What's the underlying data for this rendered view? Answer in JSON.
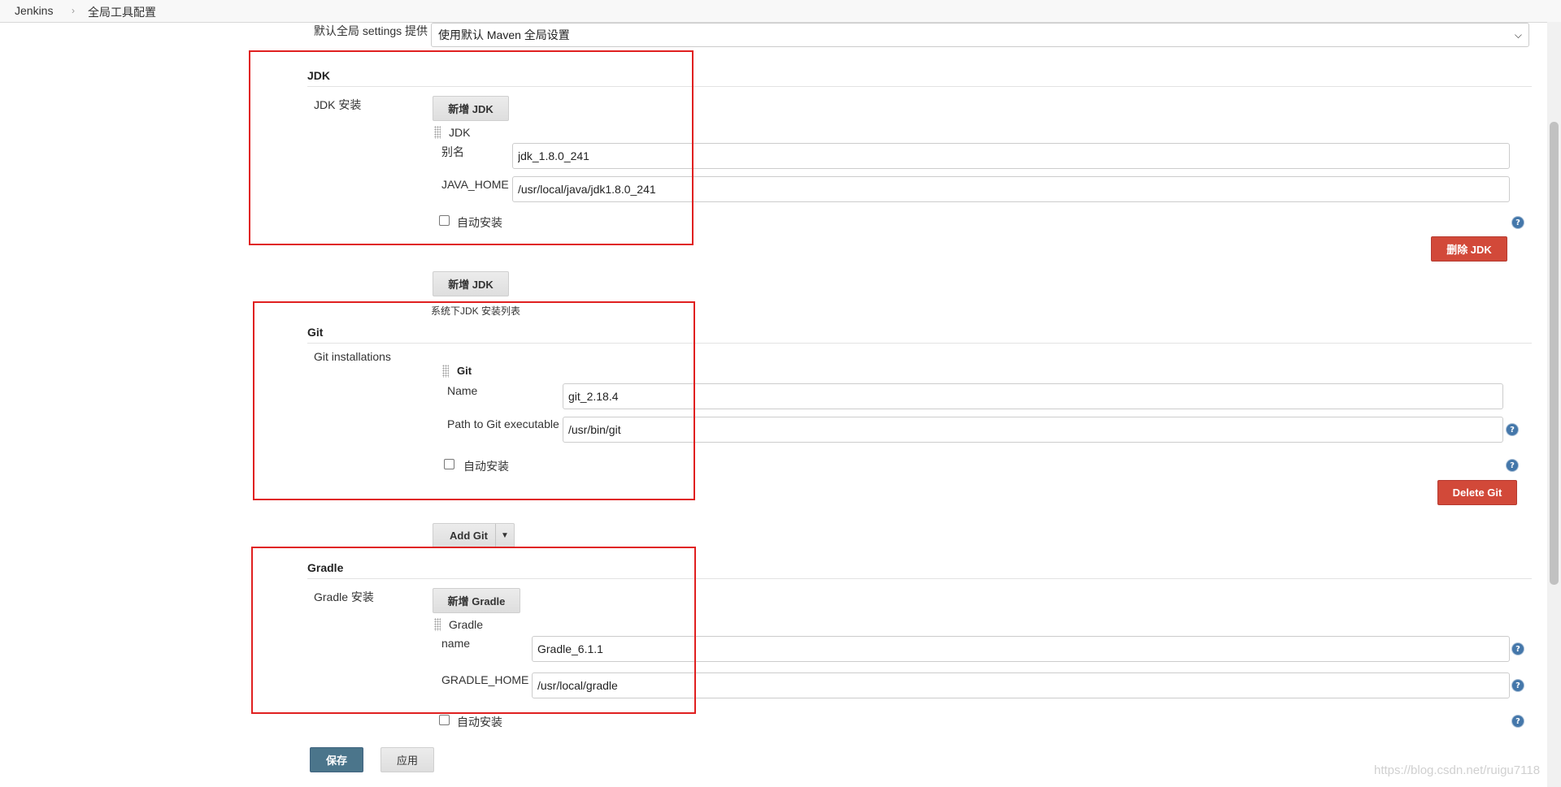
{
  "breadcrumb": {
    "items": [
      "Jenkins",
      "全局工具配置"
    ],
    "separator": "›"
  },
  "maven_settings": {
    "label": "默认全局 settings 提供",
    "selected": "使用默认 Maven 全局设置"
  },
  "jdk": {
    "section_title": "JDK",
    "install_label": "JDK 安装",
    "add_button": "新增 JDK",
    "item_title": "JDK",
    "alias_label": "别名",
    "alias_value": "jdk_1.8.0_241",
    "home_label": "JAVA_HOME",
    "home_value": "/usr/local/java/jdk1.8.0_241",
    "auto_install_label": "自动安装",
    "delete_button": "删除 JDK",
    "add_button_bottom": "新增 JDK",
    "list_hint": "系统下JDK 安装列表"
  },
  "git": {
    "section_title": "Git",
    "install_label": "Git installations",
    "item_title": "Git",
    "name_label": "Name",
    "name_value": "git_2.18.4",
    "path_label": "Path to Git executable",
    "path_value": "/usr/bin/git",
    "auto_install_label": "自动安装",
    "delete_button": "Delete Git",
    "add_button": "Add Git"
  },
  "gradle": {
    "section_title": "Gradle",
    "install_label": "Gradle 安装",
    "add_button": "新增 Gradle",
    "item_title": "Gradle",
    "name_label": "name",
    "name_value": "Gradle_6.1.1",
    "home_label": "GRADLE_HOME",
    "home_value": "/usr/local/gradle",
    "auto_install_label": "自动安装"
  },
  "footer": {
    "save_button": "保存",
    "apply_button": "应用"
  },
  "watermark": "https://blog.csdn.net/ruigu7118",
  "colors": {
    "danger": "#d24939",
    "primary": "#4b758b",
    "annotation": "#e02020",
    "help_icon": "#4477aa"
  },
  "icons": {
    "help": "help-icon",
    "caret": "chevron-down-icon",
    "grip": "drag-handle-icon"
  }
}
